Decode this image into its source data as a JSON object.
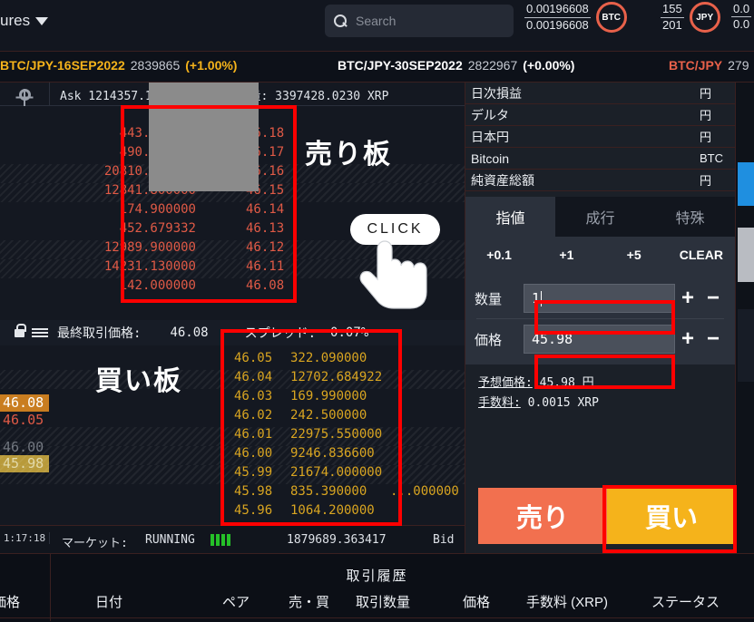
{
  "topnav": {
    "menu_label": "ures",
    "menu_icon": "chevron-down-icon",
    "search": {
      "icon": "search-icon",
      "placeholder": "Search",
      "value": ""
    },
    "tickers": [
      {
        "num": "0.00196608",
        "den": "0.00196608",
        "badge": "BTC"
      },
      {
        "num": "155",
        "den": "201",
        "badge": "JPY"
      },
      {
        "num": "0.0",
        "den": "0.0",
        "badge": ""
      }
    ]
  },
  "instruments": [
    {
      "symbol": "BTC/JPY-16SEP2022",
      "price": "2839865",
      "change": "(+1.00%)",
      "color": "#f5b31b"
    },
    {
      "symbol": "BTC/JPY-30SEP2022",
      "price": "2822967",
      "change": "(+0.00%)",
      "color": "#ffffff"
    },
    {
      "symbol": "BTC/JPY",
      "price": "279",
      "change": "",
      "color": "#e8614a"
    }
  ],
  "book": {
    "gear_icon": "gear-icon",
    "header": "Ask        1214357.15703124時間取引量: 3397428.0230 XRP",
    "ask_label": "売り板",
    "bid_label": "買い板",
    "asks": [
      {
        "qty": "443.690000",
        "price": "46.18"
      },
      {
        "qty": "490.400000",
        "price": "46.17"
      },
      {
        "qty": "20810.000000",
        "price": "46.16"
      },
      {
        "qty": "12841.800000",
        "price": "46.15"
      },
      {
        "qty": "174.900000",
        "price": "46.14"
      },
      {
        "qty": "452.679332",
        "price": "46.13"
      },
      {
        "qty": "12989.900000",
        "price": "46.12"
      },
      {
        "qty": "14231.130000",
        "price": "46.11"
      },
      {
        "qty": "142.000000",
        "price": "46.08"
      }
    ],
    "bids": [
      {
        "price": "46.05",
        "qty": "322.090000"
      },
      {
        "price": "46.04",
        "qty": "12702.684922"
      },
      {
        "price": "46.03",
        "qty": "169.990000"
      },
      {
        "price": "46.02",
        "qty": "242.500000"
      },
      {
        "price": "46.01",
        "qty": "22975.550000"
      },
      {
        "price": "46.00",
        "qty": "9246.836600"
      },
      {
        "price": "45.99",
        "qty": "21674.000000"
      },
      {
        "price": "45.98",
        "qty": "835.390000"
      },
      {
        "price": "45.96",
        "qty": "1064.200000"
      }
    ],
    "mid": {
      "lock_icon": "lock-icon",
      "menu_icon": "hamburger-icon",
      "last_label": "最終取引価格:",
      "last_value": "46.08",
      "spread_label": "スプレッド:",
      "spread_value": "0.07%"
    },
    "ladder": [
      {
        "text": "46.08",
        "style": "orange"
      },
      {
        "text": "46.05",
        "style": "red"
      },
      {
        "text": "46.00",
        "style": "gray"
      },
      {
        "text": "45.98",
        "style": "olive"
      }
    ],
    "trailing_qty": "...000000",
    "status": {
      "time": "1:17:18",
      "market_label": "マーケット:",
      "market_state": "RUNNING",
      "volume": "1879689.363417",
      "side": "Bid"
    }
  },
  "account": {
    "rows": [
      {
        "label": "日次損益",
        "value": "",
        "unit": "円"
      },
      {
        "label": "デルタ",
        "value": "",
        "unit": "円"
      },
      {
        "label": "日本円",
        "value": "",
        "unit": "円"
      },
      {
        "label": "Bitcoin",
        "value": "",
        "unit": "BTC"
      },
      {
        "label": "純資産総額",
        "value": "",
        "unit": "円"
      }
    ]
  },
  "order": {
    "tabs": [
      {
        "label": "指値",
        "active": true
      },
      {
        "label": "成行",
        "active": false
      },
      {
        "label": "特殊",
        "active": false
      }
    ],
    "quick": [
      "+0.1",
      "+1",
      "+5",
      "CLEAR"
    ],
    "quantity": {
      "label": "数量",
      "value": "1",
      "plus": "+",
      "minus": "−"
    },
    "price": {
      "label": "価格",
      "value": "45.98",
      "plus": "+",
      "minus": "−"
    },
    "estimate": {
      "label": "予想価格:",
      "value": "45.98",
      "unit": "円"
    },
    "fee": {
      "label": "手数料:",
      "value": "0.0015",
      "unit": "XRP"
    },
    "sell_button": "売り",
    "buy_button": "買い",
    "sell_color": "#f2704f",
    "buy_color": "#f5b31b"
  },
  "history": {
    "title": "取引履歴",
    "left_partial": "価格",
    "columns": [
      "日付",
      "ペア",
      "売・買",
      "取引数量",
      "価格",
      "手数料 (XRP)",
      "ステータス"
    ]
  },
  "annotation": {
    "click_label": "CLICK",
    "box_color": "#ff0000"
  }
}
